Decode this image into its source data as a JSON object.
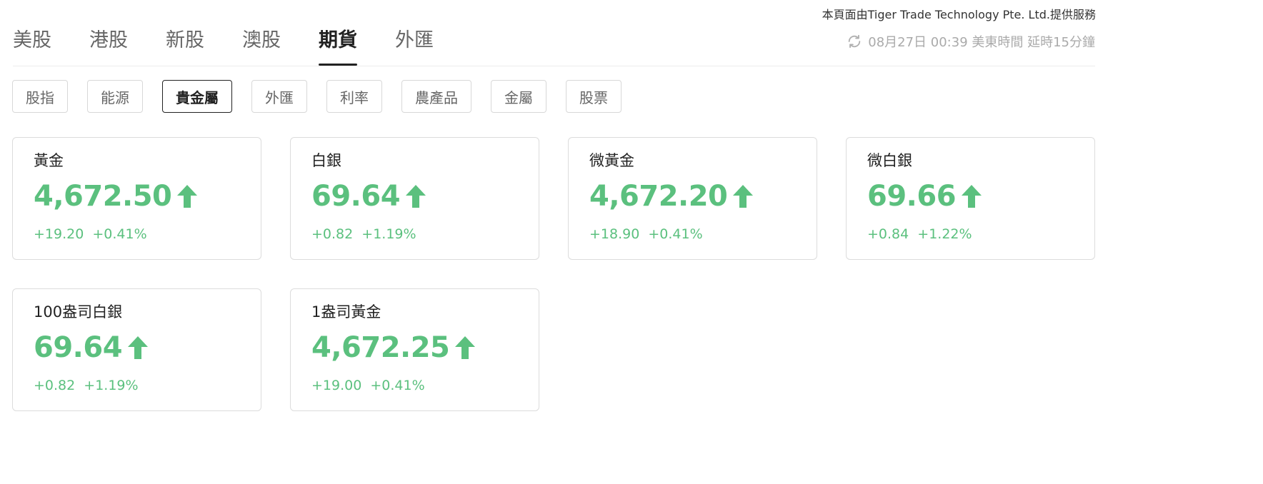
{
  "provider_text": "本頁面由Tiger Trade Technology Pte. Ltd.提供服務",
  "tabs": [
    {
      "label": "美股",
      "active": false
    },
    {
      "label": "港股",
      "active": false
    },
    {
      "label": "新股",
      "active": false
    },
    {
      "label": "澳股",
      "active": false
    },
    {
      "label": "期貨",
      "active": true
    },
    {
      "label": "外匯",
      "active": false
    }
  ],
  "timestamp": "08月27日 00:39 美東時間 延時15分鐘",
  "categories": [
    {
      "label": "股指",
      "active": false
    },
    {
      "label": "能源",
      "active": false
    },
    {
      "label": "貴金屬",
      "active": true
    },
    {
      "label": "外匯",
      "active": false
    },
    {
      "label": "利率",
      "active": false
    },
    {
      "label": "農產品",
      "active": false
    },
    {
      "label": "金屬",
      "active": false
    },
    {
      "label": "股票",
      "active": false
    }
  ],
  "cards": [
    {
      "name": "黃金",
      "price": "4,672.50",
      "change": "+19.20",
      "percent": "+0.41%",
      "direction": "up"
    },
    {
      "name": "白銀",
      "price": "69.64",
      "change": "+0.82",
      "percent": "+1.19%",
      "direction": "up"
    },
    {
      "name": "微黃金",
      "price": "4,672.20",
      "change": "+18.90",
      "percent": "+0.41%",
      "direction": "up"
    },
    {
      "name": "微白銀",
      "price": "69.66",
      "change": "+0.84",
      "percent": "+1.22%",
      "direction": "up"
    },
    {
      "name": "100盎司白銀",
      "price": "69.64",
      "change": "+0.82",
      "percent": "+1.19%",
      "direction": "up"
    },
    {
      "name": "1盎司黃金",
      "price": "4,672.25",
      "change": "+19.00",
      "percent": "+0.41%",
      "direction": "up"
    }
  ],
  "colors": {
    "up": "#5bc07e",
    "active_text": "#222222",
    "inactive_text": "#666666",
    "muted_text": "#aaaaaa",
    "border": "#dcdcdc"
  },
  "icons": {
    "refresh": "refresh-icon",
    "up": "arrow-up-icon"
  }
}
